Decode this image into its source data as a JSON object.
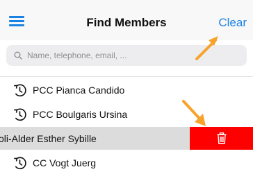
{
  "header": {
    "title": "Find Members",
    "clear_label": "Clear",
    "menu_icon": "hamburger-menu-icon"
  },
  "search": {
    "placeholder": "Name, telephone, email, ...",
    "value": "",
    "icon": "search-icon"
  },
  "history": {
    "icon": "history-clock-icon",
    "items": [
      {
        "label": "PCC Pianca Candido"
      },
      {
        "label": "PCC Boulgaris Ursina"
      },
      {
        "label": "oli-Alder Esther Sybille",
        "swiped": true
      },
      {
        "label": "CC Vogt Juerg"
      }
    ]
  },
  "swipe_action": {
    "icon": "trash-icon",
    "color": "#fe0000"
  },
  "colors": {
    "accent": "#1a82e2",
    "annotation_arrow": "#f7a22b"
  }
}
